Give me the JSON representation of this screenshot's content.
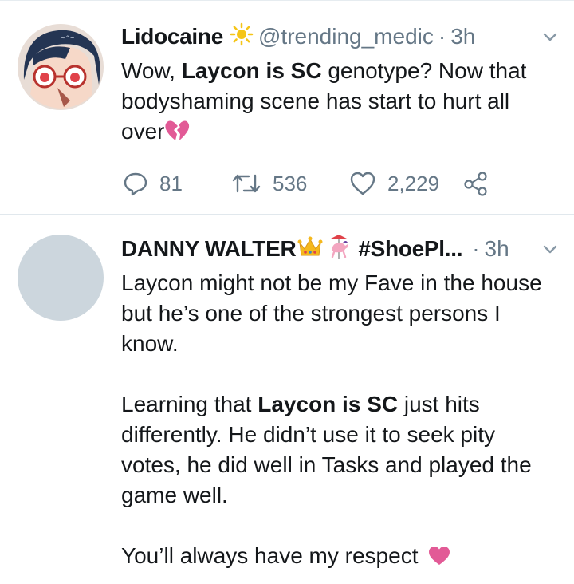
{
  "tweets": [
    {
      "author_name": "Lidocaine",
      "handle": "@trending_medic",
      "time": "3h",
      "separator": "·",
      "text_parts": [
        "Wow, ",
        "Laycon is SC",
        " genotype? Now that bodyshaming scene has start to hurt all over"
      ],
      "reply_count": "81",
      "retweet_count": "536",
      "like_count": "2,229",
      "name_emoji_icon": "sun-icon",
      "text_emoji_icon": "broken-heart-icon"
    },
    {
      "author_name": "DANNY WALTER",
      "handle_truncated": "#ShoePl...",
      "time": "3h",
      "separator": "·",
      "paragraph1": "Laycon might not be my Fave in the house but he’s one of the strongest persons I know.",
      "paragraph2_parts": [
        "Learning that ",
        "Laycon is SC",
        " just hits differently. He didn’t use it to seek pity votes, he did well in Tasks and played the game well."
      ],
      "paragraph3": "You’ll always have my respect",
      "name_emoji_icons": [
        "crown-icon",
        "carousel-horse-icon"
      ],
      "text_emoji_icon": "heart-icon"
    }
  ],
  "colors": {
    "text": "#14171a",
    "secondary": "#657786",
    "divider": "#e1e8ed",
    "heart_pink": "#e25a96",
    "sun_yellow": "#f5c518",
    "placeholder_avatar": "#ccd6dd"
  }
}
